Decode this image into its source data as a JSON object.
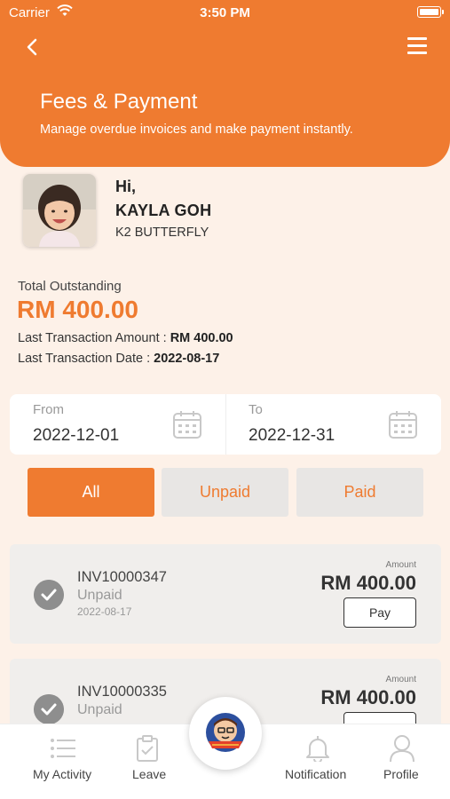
{
  "status_bar": {
    "carrier": "Carrier",
    "time": "3:50 PM"
  },
  "header": {
    "title": "Fees & Payment",
    "subtitle": "Manage overdue invoices and make payment instantly."
  },
  "student": {
    "greeting": "Hi,",
    "name": "KAYLA GOH",
    "class": "K2 BUTTERFLY"
  },
  "summary": {
    "total_label": "Total Outstanding",
    "total_amount": "RM 400.00",
    "last_amount_label": "Last Transaction Amount : ",
    "last_amount_value": "RM 400.00",
    "last_date_label": "Last Transaction Date : ",
    "last_date_value": "2022-08-17"
  },
  "date_filter": {
    "from_label": "From",
    "from_value": "2022-12-01",
    "to_label": "To",
    "to_value": "2022-12-31"
  },
  "filters": {
    "all": "All",
    "unpaid": "Unpaid",
    "paid": "Paid",
    "selected": "All"
  },
  "invoices": [
    {
      "number": "INV10000347",
      "status": "Unpaid",
      "date": "2022-08-17",
      "amount_label": "Amount",
      "amount": "RM 400.00",
      "pay_label": "Pay"
    },
    {
      "number": "INV10000335",
      "status": "Unpaid",
      "amount_label": "Amount",
      "amount": "RM 400.00"
    }
  ],
  "tabbar": {
    "my_activity": "My Activity",
    "leave": "Leave",
    "notification": "Notification",
    "profile": "Profile"
  },
  "colors": {
    "accent": "#ef7b30",
    "background": "#fdf1e8"
  }
}
